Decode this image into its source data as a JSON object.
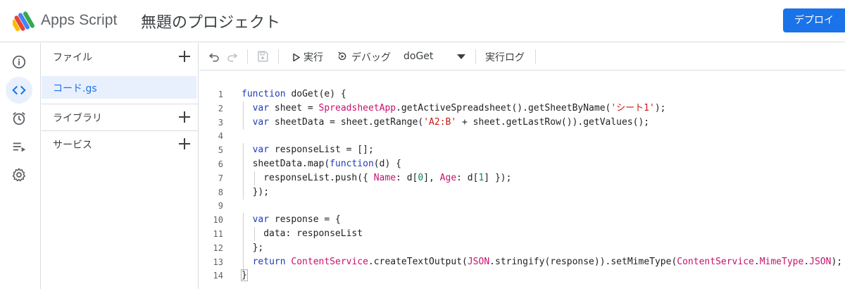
{
  "header": {
    "app_name": "Apps Script",
    "project_title": "無題のプロジェクト",
    "deploy_label": "デプロイ"
  },
  "rail": {
    "items": [
      {
        "icon": "info-icon",
        "label": "overview"
      },
      {
        "icon": "code-icon",
        "label": "editor",
        "active": true
      },
      {
        "icon": "alarm-icon",
        "label": "triggers"
      },
      {
        "icon": "list-run-icon",
        "label": "executions"
      },
      {
        "icon": "gear-icon",
        "label": "settings"
      }
    ]
  },
  "files_panel": {
    "files_label": "ファイル",
    "files": [
      "コード.gs"
    ],
    "libraries_label": "ライブラリ",
    "services_label": "サービス"
  },
  "toolbar": {
    "run_label": "実行",
    "debug_label": "デバッグ",
    "function_name": "doGet",
    "log_label": "実行ログ"
  },
  "colors": {
    "accent": "#1a73e8",
    "selected_bg": "#e8f0fe",
    "keyword": "#1f3bb3",
    "string": "#c41a16",
    "number": "#098658",
    "identifier": "#c5126e"
  },
  "editor": {
    "line_numbers": [
      "1",
      "2",
      "3",
      "4",
      "5",
      "6",
      "7",
      "8",
      "9",
      "10",
      "11",
      "12",
      "13",
      "14"
    ],
    "lines": [
      [
        {
          "t": "kw",
          "s": "function"
        },
        {
          "t": "pn",
          "s": " doGet(e) {"
        }
      ],
      [
        {
          "t": "kw",
          "s": "var"
        },
        {
          "t": "pn",
          "s": " sheet = "
        },
        {
          "t": "cls",
          "s": "SpreadsheetApp"
        },
        {
          "t": "pn",
          "s": ".getActiveSpreadsheet().getSheetByName("
        },
        {
          "t": "str",
          "s": "'シート1'"
        },
        {
          "t": "pn",
          "s": ");"
        }
      ],
      [
        {
          "t": "kw",
          "s": "var"
        },
        {
          "t": "pn",
          "s": " sheetData = sheet.getRange("
        },
        {
          "t": "str",
          "s": "'A2:B'"
        },
        {
          "t": "pn",
          "s": " + sheet.getLastRow()).getValues();"
        }
      ],
      [],
      [
        {
          "t": "kw",
          "s": "var"
        },
        {
          "t": "pn",
          "s": " responseList = [];"
        }
      ],
      [
        {
          "t": "pn",
          "s": "sheetData.map("
        },
        {
          "t": "kw",
          "s": "function"
        },
        {
          "t": "pn",
          "s": "(d) {"
        }
      ],
      [
        {
          "t": "pn",
          "s": "responseList.push({ "
        },
        {
          "t": "prop",
          "s": "Name"
        },
        {
          "t": "pn",
          "s": ": d["
        },
        {
          "t": "num",
          "s": "0"
        },
        {
          "t": "pn",
          "s": "], "
        },
        {
          "t": "prop",
          "s": "Age"
        },
        {
          "t": "pn",
          "s": ": d["
        },
        {
          "t": "num",
          "s": "1"
        },
        {
          "t": "pn",
          "s": "] });"
        }
      ],
      [
        {
          "t": "pn",
          "s": "});"
        }
      ],
      [],
      [
        {
          "t": "kw",
          "s": "var"
        },
        {
          "t": "pn",
          "s": " response = {"
        }
      ],
      [
        {
          "t": "pn",
          "s": "data: responseList"
        }
      ],
      [
        {
          "t": "pn",
          "s": "};"
        }
      ],
      [
        {
          "t": "kw",
          "s": "return"
        },
        {
          "t": "pn",
          "s": " "
        },
        {
          "t": "cls",
          "s": "ContentService"
        },
        {
          "t": "pn",
          "s": ".createTextOutput("
        },
        {
          "t": "cls",
          "s": "JSON"
        },
        {
          "t": "pn",
          "s": ".stringify(response)).setMimeType("
        },
        {
          "t": "cls",
          "s": "ContentService"
        },
        {
          "t": "pn",
          "s": "."
        },
        {
          "t": "cls",
          "s": "MimeType"
        },
        {
          "t": "pn",
          "s": "."
        },
        {
          "t": "cls",
          "s": "JSON"
        },
        {
          "t": "pn",
          "s": ");"
        }
      ],
      [
        {
          "t": "pn",
          "s": "}"
        }
      ]
    ],
    "indents": [
      0,
      1,
      1,
      0,
      1,
      1,
      2,
      1,
      0,
      1,
      2,
      1,
      1,
      0
    ]
  }
}
